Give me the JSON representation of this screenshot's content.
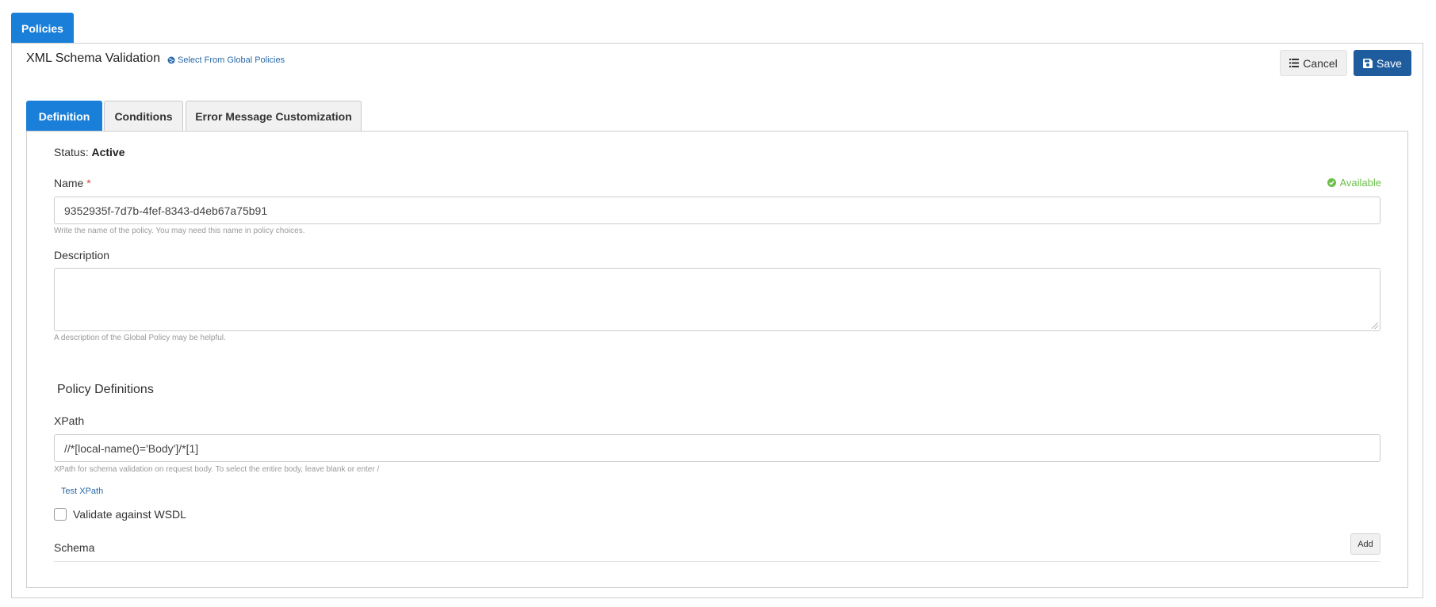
{
  "top_tab": {
    "label": "Policies"
  },
  "header": {
    "title": "XML Schema Validation",
    "global_link": "Select From Global Policies",
    "cancel_label": "Cancel",
    "save_label": "Save"
  },
  "tabs": [
    {
      "label": "Definition",
      "active": true
    },
    {
      "label": "Conditions",
      "active": false
    },
    {
      "label": "Error Message Customization",
      "active": false
    }
  ],
  "status": {
    "prefix": "Status:",
    "value": "Active"
  },
  "name": {
    "label": "Name",
    "required_mark": "*",
    "availability": "Available",
    "value": "9352935f-7d7b-4fef-8343-d4eb67a75b91",
    "help": "Write the name of the policy. You may need this name in policy choices."
  },
  "description": {
    "label": "Description",
    "value": "",
    "help": "A description of the Global Policy may be helpful."
  },
  "policy_definitions": {
    "title": "Policy Definitions",
    "xpath_label": "XPath",
    "xpath_value": "//*[local-name()='Body']/*[1]",
    "xpath_help": "XPath for schema validation on request body. To select the entire body, leave blank or enter /",
    "test_xpath_label": "Test XPath",
    "validate_wsdl_label": "Validate against WSDL",
    "validate_wsdl_checked": false,
    "schema_label": "Schema",
    "add_label": "Add"
  },
  "colors": {
    "primary_tab": "#1a7fd9",
    "save_button": "#1f5c9e",
    "available": "#6cc04a",
    "link": "#2a6aa8",
    "required": "#e0433a"
  },
  "icons": {
    "global_link": "globe-icon",
    "cancel": "list-icon",
    "save": "floppy-disk-icon",
    "available": "check-circle-icon"
  }
}
